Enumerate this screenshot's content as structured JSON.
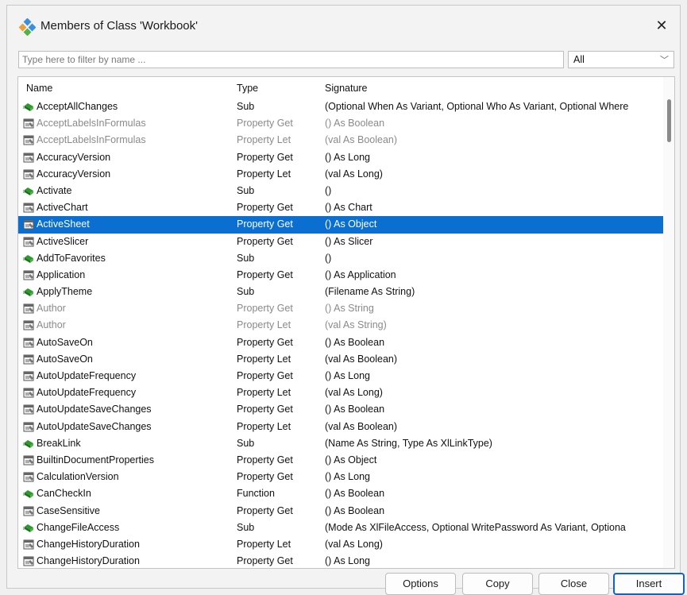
{
  "window": {
    "title": "Members of Class 'Workbook'"
  },
  "filter": {
    "placeholder": "Type here to filter by name ...",
    "scope": "All"
  },
  "columns": {
    "name": "Name",
    "type": "Type",
    "signature": "Signature"
  },
  "rows": [
    {
      "name": "AcceptAllChanges",
      "type": "Sub",
      "signature": "(Optional When As Variant, Optional Who As Variant, Optional Where",
      "kind": "method",
      "dim": false,
      "selected": false
    },
    {
      "name": "AcceptLabelsInFormulas",
      "type": "Property Get",
      "signature": "() As Boolean",
      "kind": "property",
      "dim": true,
      "selected": false
    },
    {
      "name": "AcceptLabelsInFormulas",
      "type": "Property Let",
      "signature": "(val As Boolean)",
      "kind": "property",
      "dim": true,
      "selected": false
    },
    {
      "name": "AccuracyVersion",
      "type": "Property Get",
      "signature": "() As Long",
      "kind": "property",
      "dim": false,
      "selected": false
    },
    {
      "name": "AccuracyVersion",
      "type": "Property Let",
      "signature": "(val As Long)",
      "kind": "property",
      "dim": false,
      "selected": false
    },
    {
      "name": "Activate",
      "type": "Sub",
      "signature": "()",
      "kind": "method",
      "dim": false,
      "selected": false
    },
    {
      "name": "ActiveChart",
      "type": "Property Get",
      "signature": "() As Chart",
      "kind": "property",
      "dim": false,
      "selected": false
    },
    {
      "name": "ActiveSheet",
      "type": "Property Get",
      "signature": "() As Object",
      "kind": "property",
      "dim": false,
      "selected": true
    },
    {
      "name": "ActiveSlicer",
      "type": "Property Get",
      "signature": "() As Slicer",
      "kind": "property",
      "dim": false,
      "selected": false
    },
    {
      "name": "AddToFavorites",
      "type": "Sub",
      "signature": "()",
      "kind": "method",
      "dim": false,
      "selected": false
    },
    {
      "name": "Application",
      "type": "Property Get",
      "signature": "() As Application",
      "kind": "property",
      "dim": false,
      "selected": false
    },
    {
      "name": "ApplyTheme",
      "type": "Sub",
      "signature": "(Filename As String)",
      "kind": "method",
      "dim": false,
      "selected": false
    },
    {
      "name": "Author",
      "type": "Property Get",
      "signature": "() As String",
      "kind": "property",
      "dim": true,
      "selected": false
    },
    {
      "name": "Author",
      "type": "Property Let",
      "signature": "(val As String)",
      "kind": "property",
      "dim": true,
      "selected": false
    },
    {
      "name": "AutoSaveOn",
      "type": "Property Get",
      "signature": "() As Boolean",
      "kind": "property",
      "dim": false,
      "selected": false
    },
    {
      "name": "AutoSaveOn",
      "type": "Property Let",
      "signature": "(val As Boolean)",
      "kind": "property",
      "dim": false,
      "selected": false
    },
    {
      "name": "AutoUpdateFrequency",
      "type": "Property Get",
      "signature": "() As Long",
      "kind": "property",
      "dim": false,
      "selected": false
    },
    {
      "name": "AutoUpdateFrequency",
      "type": "Property Let",
      "signature": "(val As Long)",
      "kind": "property",
      "dim": false,
      "selected": false
    },
    {
      "name": "AutoUpdateSaveChanges",
      "type": "Property Get",
      "signature": "() As Boolean",
      "kind": "property",
      "dim": false,
      "selected": false
    },
    {
      "name": "AutoUpdateSaveChanges",
      "type": "Property Let",
      "signature": "(val As Boolean)",
      "kind": "property",
      "dim": false,
      "selected": false
    },
    {
      "name": "BreakLink",
      "type": "Sub",
      "signature": "(Name As String, Type As XlLinkType)",
      "kind": "method",
      "dim": false,
      "selected": false
    },
    {
      "name": "BuiltinDocumentProperties",
      "type": "Property Get",
      "signature": "() As Object",
      "kind": "property",
      "dim": false,
      "selected": false
    },
    {
      "name": "CalculationVersion",
      "type": "Property Get",
      "signature": "() As Long",
      "kind": "property",
      "dim": false,
      "selected": false
    },
    {
      "name": "CanCheckIn",
      "type": "Function",
      "signature": "() As Boolean",
      "kind": "method",
      "dim": false,
      "selected": false
    },
    {
      "name": "CaseSensitive",
      "type": "Property Get",
      "signature": "() As Boolean",
      "kind": "property",
      "dim": false,
      "selected": false
    },
    {
      "name": "ChangeFileAccess",
      "type": "Sub",
      "signature": "(Mode As XlFileAccess, Optional WritePassword As Variant, Optiona",
      "kind": "method",
      "dim": false,
      "selected": false
    },
    {
      "name": "ChangeHistoryDuration",
      "type": "Property Let",
      "signature": "(val As Long)",
      "kind": "property",
      "dim": false,
      "selected": false
    },
    {
      "name": "ChangeHistoryDuration",
      "type": "Property Get",
      "signature": "() As Long",
      "kind": "property",
      "dim": false,
      "selected": false
    }
  ],
  "buttons": {
    "options": "Options",
    "copy": "Copy",
    "close": "Close",
    "insert": "Insert"
  },
  "colors": {
    "selection": "#0a6fd0",
    "method_icon": "#2e9a2e",
    "primary_border": "#1463c4"
  },
  "icons": {
    "title": "class-members-icon",
    "method": "method-icon",
    "property": "property-icon",
    "close": "close-icon"
  }
}
